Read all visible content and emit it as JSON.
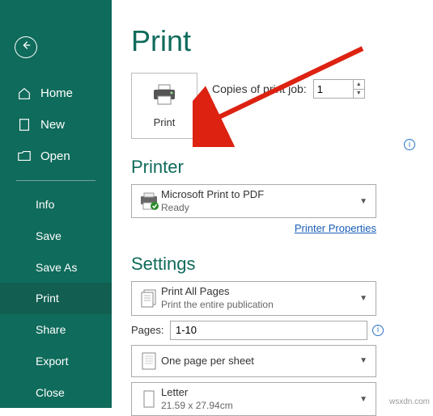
{
  "sidebar": {
    "home": "Home",
    "new": "New",
    "open": "Open",
    "items": [
      "Info",
      "Save",
      "Save As",
      "Print",
      "Share",
      "Export",
      "Close"
    ],
    "active_index": 3
  },
  "page": {
    "title": "Print"
  },
  "print": {
    "button_label": "Print",
    "copies_label": "Copies of print job:",
    "copies_value": "1"
  },
  "printer": {
    "section_title": "Printer",
    "name": "Microsoft Print to PDF",
    "status": "Ready",
    "properties_link": "Printer Properties"
  },
  "settings": {
    "section_title": "Settings",
    "range": {
      "title": "Print All Pages",
      "sub": "Print the entire publication"
    },
    "pages_label": "Pages:",
    "pages_value": "1-10",
    "layout": {
      "title": "One page per sheet"
    },
    "paper": {
      "title": "Letter",
      "sub": "21.59 x 27.94cm"
    }
  },
  "watermark": "wsxdn.com"
}
